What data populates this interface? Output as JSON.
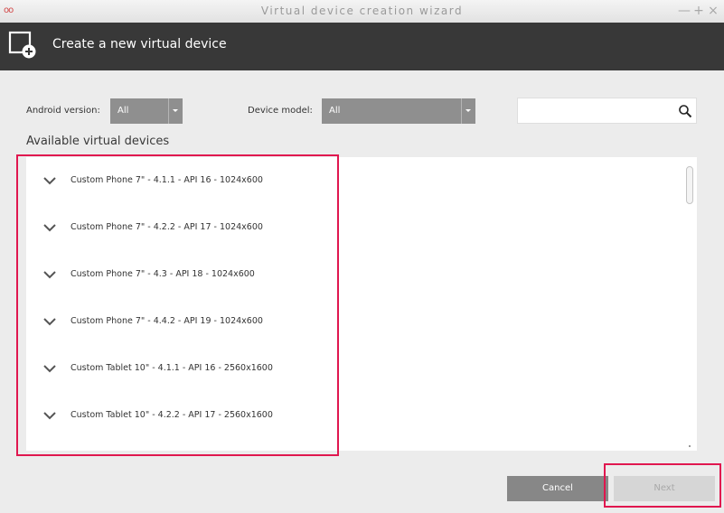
{
  "window": {
    "title": "Virtual device creation wizard",
    "app_icon": "oo",
    "minimize": "—",
    "maximize": "+",
    "close": "×"
  },
  "header": {
    "title": "Create a new virtual device",
    "icon": "new-device-icon"
  },
  "filters": {
    "android_version_label": "Android version:",
    "android_version_value": "All",
    "device_model_label": "Device model:",
    "device_model_value": "All",
    "search_value": ""
  },
  "devices": {
    "section_title": "Available virtual devices",
    "items": [
      {
        "label": "Custom Phone 7\" - 4.1.1 - API 16 - 1024x600"
      },
      {
        "label": "Custom Phone 7\" - 4.2.2 - API 17 - 1024x600"
      },
      {
        "label": "Custom Phone 7\" - 4.3 - API 18 - 1024x600"
      },
      {
        "label": "Custom Phone 7\" - 4.4.2 - API 19 - 1024x600"
      },
      {
        "label": "Custom Tablet 10\" - 4.1.1 - API 16 - 2560x1600"
      },
      {
        "label": "Custom Tablet 10\" - 4.2.2 - API 17 - 2560x1600"
      }
    ]
  },
  "buttons": {
    "cancel": "Cancel",
    "next": "Next"
  },
  "colors": {
    "header_bg": "#383838",
    "highlight": "#e0174f",
    "select_bg": "#8f8f8f"
  }
}
